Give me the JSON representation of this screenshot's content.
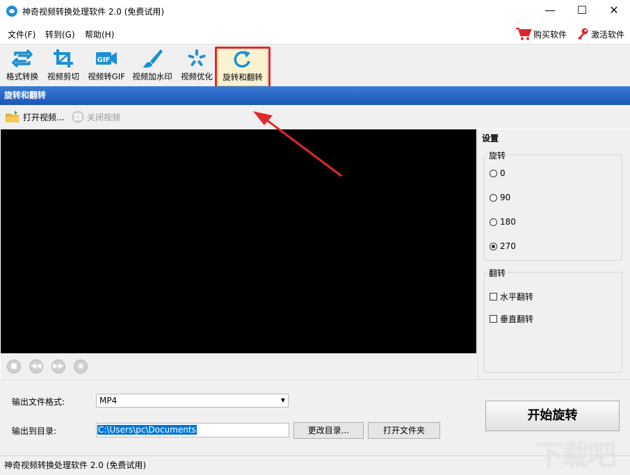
{
  "window": {
    "title": "神奇视频转换处理软件 2.0 (免费试用)",
    "minimize_glyph": "—",
    "maximize_glyph": "☐",
    "close_glyph": "✕"
  },
  "menu": {
    "items": [
      "文件(F)",
      "转到(G)",
      "帮助(H)"
    ],
    "buy_label": "购买软件",
    "activate_label": "激活软件"
  },
  "toolbar": {
    "tools": [
      {
        "label": "格式转换",
        "icon": "format-convert-icon"
      },
      {
        "label": "视频剪切",
        "icon": "crop-icon"
      },
      {
        "label": "视频转GIF",
        "icon": "gif-icon"
      },
      {
        "label": "视频加水印",
        "icon": "brush-icon"
      },
      {
        "label": "视频优化",
        "icon": "optimize-icon"
      },
      {
        "label": "旋转和翻转",
        "icon": "rotate-icon",
        "active": true
      }
    ],
    "gif_badge": "GIF"
  },
  "section_header": "旋转和翻转",
  "video_toolbar": {
    "open_label": "打开视频...",
    "close_label": "关闭视频"
  },
  "settings": {
    "title": "设置",
    "rotate_group": "旋转",
    "rotate_options": [
      "0",
      "90",
      "180",
      "270"
    ],
    "rotate_selected": "270",
    "flip_group": "翻转",
    "flip_options": [
      "水平翻转",
      "垂直翻转"
    ]
  },
  "output": {
    "format_label": "输出文件格式:",
    "format_value": "MP4",
    "dir_label": "输出到目录:",
    "dir_value": "C:\\Users\\pc\\Documents",
    "change_dir_label": "更改目录...",
    "open_folder_label": "打开文件夹",
    "start_label": "开始旋转"
  },
  "status_text": "神奇视频转换处理软件 2.0 (免费试用)",
  "watermark": "下载吧",
  "colors": {
    "accent_blue": "#1a56b8",
    "highlight_red": "#e2292a",
    "icon_blue": "#1a8fd6"
  }
}
